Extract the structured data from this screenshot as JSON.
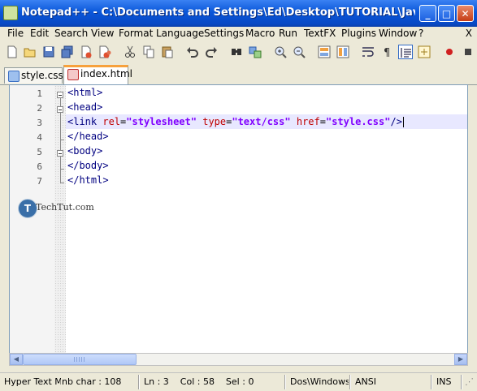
{
  "window": {
    "title": "Notepad++ - C:\\Documents and Settings\\Ed\\Desktop\\TUTORIAL\\JavaScript\\c...",
    "buttons": {
      "minimize": "_",
      "maximize": "□",
      "close": "✕"
    }
  },
  "menu": [
    "File",
    "Edit",
    "Search",
    "View",
    "Format",
    "Language",
    "Settings",
    "Macro",
    "Run",
    "TextFX",
    "Plugins",
    "Window",
    "?"
  ],
  "menu_close": "X",
  "toolbar_icons": [
    "new-file-icon",
    "open-file-icon",
    "save-icon",
    "save-all-icon",
    "close-file-icon",
    "close-all-icon",
    "print-icon",
    "cut-icon",
    "copy-icon",
    "paste-icon",
    "undo-icon",
    "redo-icon",
    "find-icon",
    "replace-icon",
    "zoom-in-icon",
    "zoom-out-icon",
    "sync-vertical-icon",
    "sync-horizontal-icon",
    "word-wrap-icon",
    "show-all-chars-icon",
    "indent-guide-icon",
    "user-lang-icon",
    "record-macro-icon",
    "stop-record-icon"
  ],
  "tabs": [
    {
      "label": "style.css",
      "active": false
    },
    {
      "label": "index.html",
      "active": true
    }
  ],
  "editor": {
    "line_numbers": [
      "1",
      "2",
      "3",
      "4",
      "5",
      "6",
      "7"
    ],
    "lines": [
      [
        {
          "text": "<html>",
          "kind": "tag"
        }
      ],
      [
        {
          "text": "<head>",
          "kind": "tag"
        }
      ],
      [
        {
          "text": "<link ",
          "kind": "tag"
        },
        {
          "text": "rel",
          "kind": "attr"
        },
        {
          "text": "=",
          "kind": "punct"
        },
        {
          "text": "\"stylesheet\"",
          "kind": "value"
        },
        {
          "text": " ",
          "kind": "punct"
        },
        {
          "text": "type",
          "kind": "attr"
        },
        {
          "text": "=",
          "kind": "punct"
        },
        {
          "text": "\"text/css\"",
          "kind": "value"
        },
        {
          "text": " ",
          "kind": "punct"
        },
        {
          "text": "href",
          "kind": "attr"
        },
        {
          "text": "=",
          "kind": "punct"
        },
        {
          "text": "\"style.css\"",
          "kind": "value"
        },
        {
          "text": "/>",
          "kind": "tag"
        }
      ],
      [
        {
          "text": "</head>",
          "kind": "tag"
        }
      ],
      [
        {
          "text": "<body>",
          "kind": "tag"
        }
      ],
      [
        {
          "text": "</body>",
          "kind": "tag"
        }
      ],
      [
        {
          "text": "</html>",
          "kind": "tag"
        }
      ]
    ],
    "current_line": 3,
    "colors": {
      "tag": "#000080",
      "attr": "#c00000",
      "value": "#8000ff",
      "current_line_bg": "#e8e8ff"
    }
  },
  "watermark": {
    "logo_letter": "T",
    "text": "TechTut.com"
  },
  "statusbar": {
    "language": "Hyper Text Ma",
    "char_count": "nb char : 108",
    "position": "Ln : 3    Col : 58    Sel : 0",
    "eol": "Dos\\Windows",
    "encoding": "ANSI",
    "mode": "INS"
  }
}
